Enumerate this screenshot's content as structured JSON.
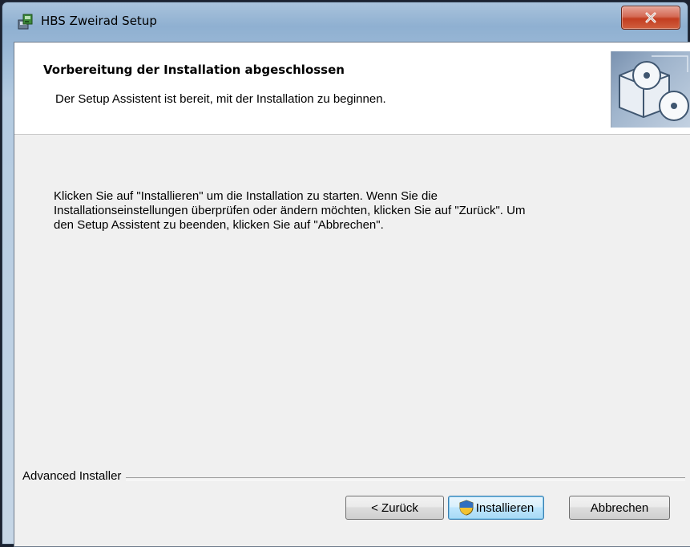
{
  "window": {
    "title": "HBS Zweirad Setup",
    "close_icon": "close-icon"
  },
  "banner": {
    "title": "Vorbereitung der Installation abgeschlossen",
    "subtitle": "Der Setup Assistent ist bereit, mit der Installation zu beginnen.",
    "image_icon": "setup-disc-icon"
  },
  "body": {
    "text": "Klicken Sie auf \"Installieren\" um die Installation zu starten. Wenn Sie die\nInstallationseinstellungen überprüfen oder ändern möchten, klicken Sie auf \"Zurück\". Um\nden Setup Assistent zu beenden, klicken Sie auf \"Abbrechen\"."
  },
  "footer": {
    "brand": "Advanced Installer",
    "back_label": "< Zurück",
    "install_label": "Installieren",
    "install_icon": "uac-shield-icon",
    "cancel_label": "Abbrechen"
  },
  "colors": {
    "close_button": "#c33d20",
    "default_button_border": "#3c7fb1",
    "client_background": "#f0f0f0"
  }
}
